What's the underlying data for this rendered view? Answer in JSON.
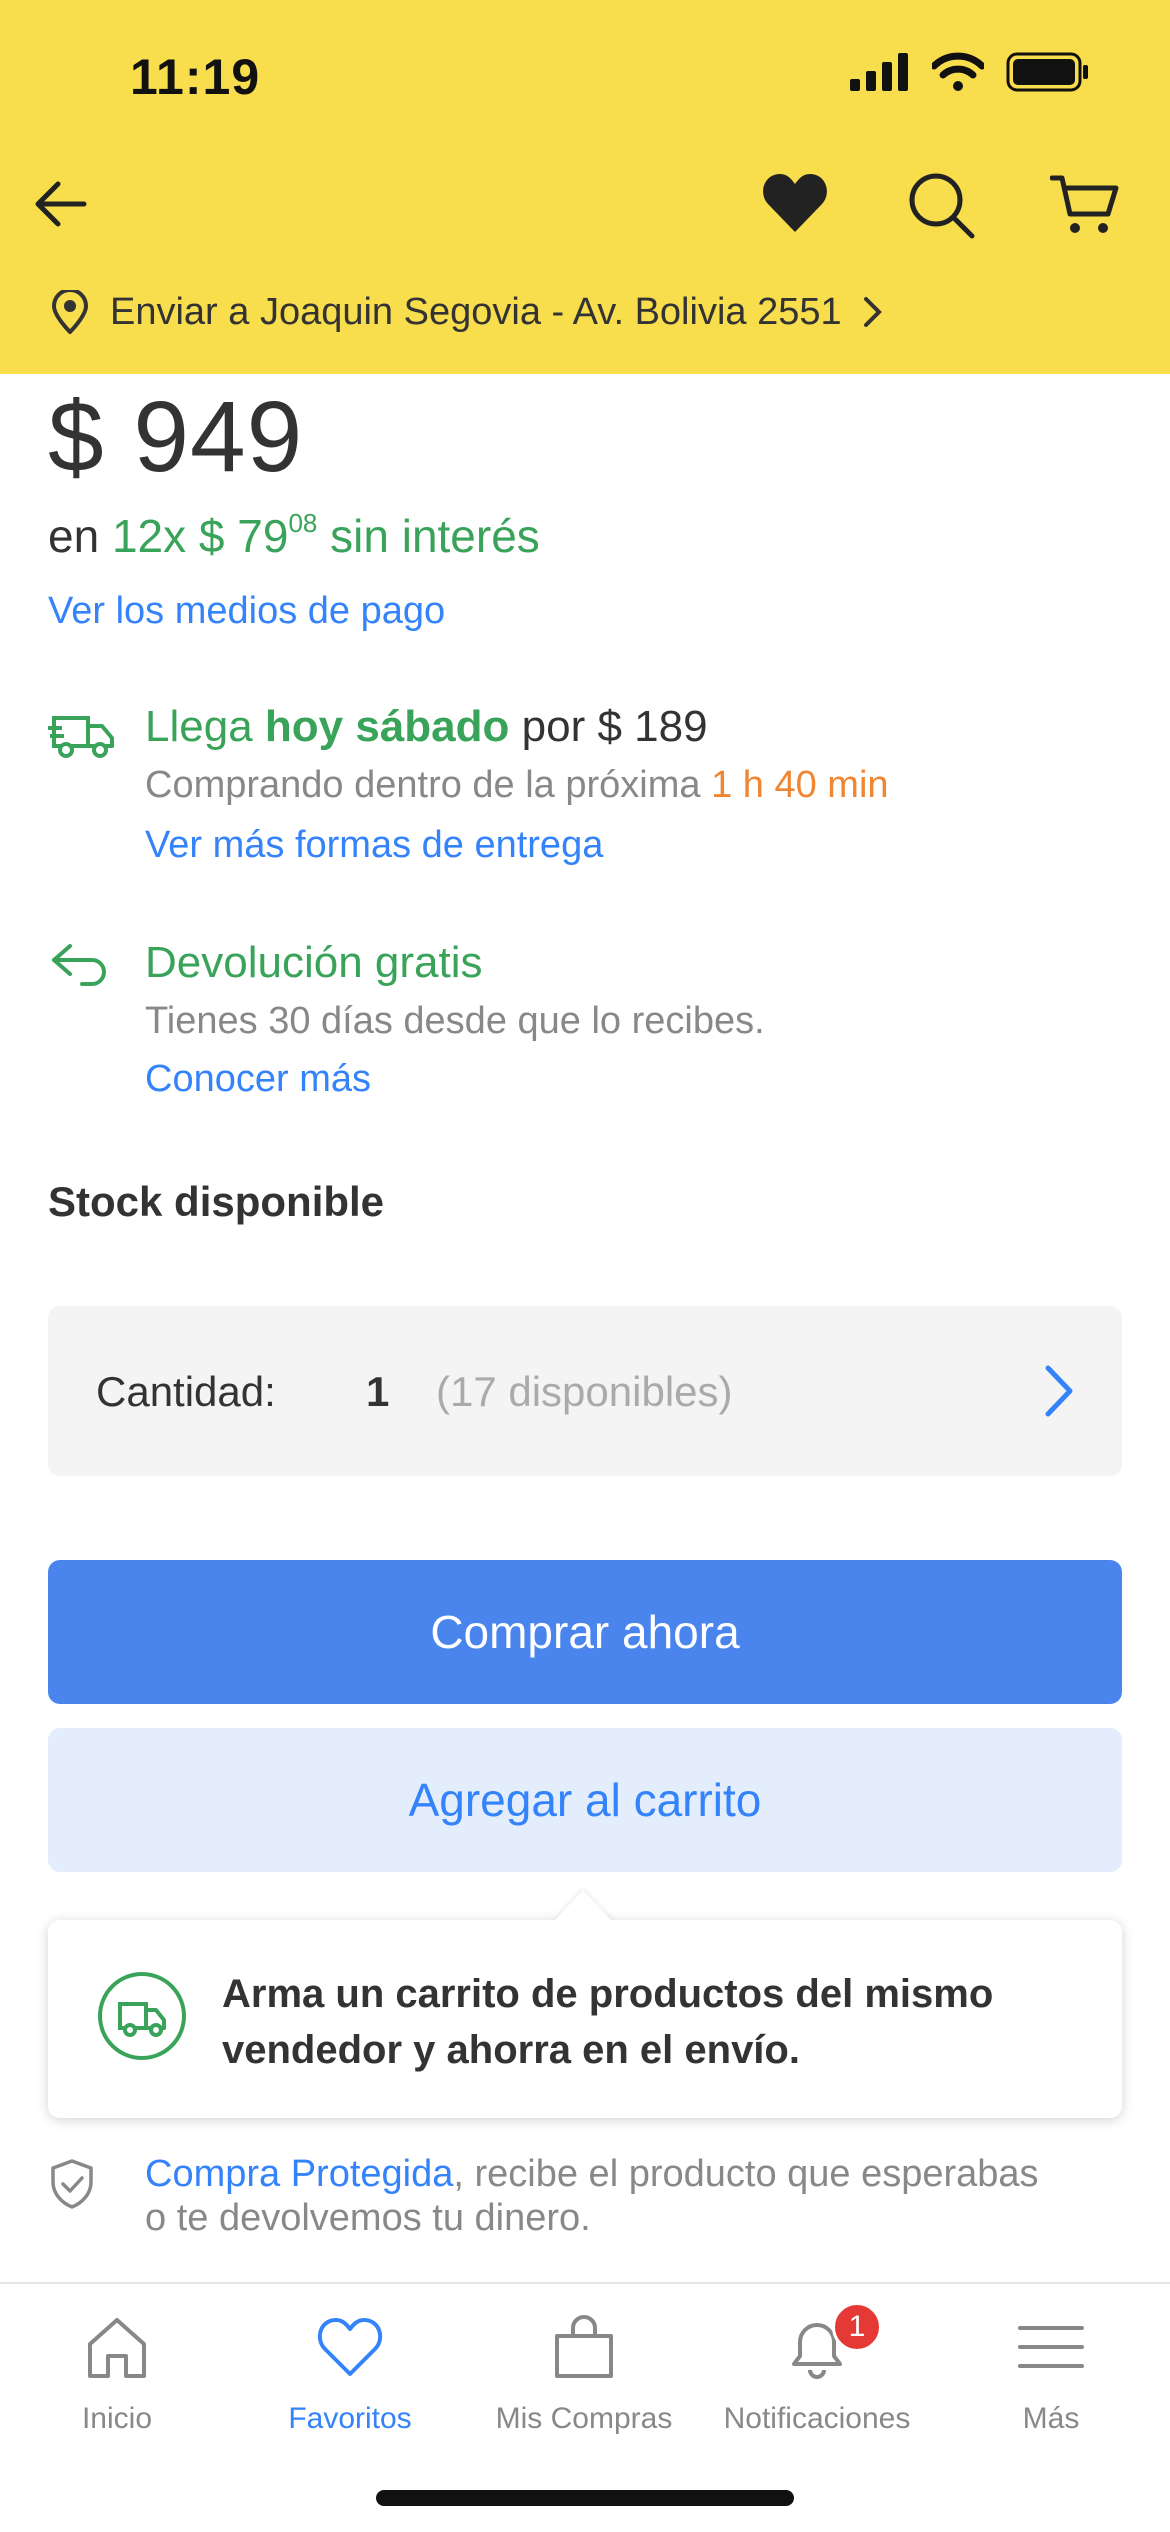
{
  "status_bar": {
    "time": "11:19"
  },
  "header": {
    "ship_to": "Enviar a Joaquin Segovia - Av. Bolivia 2551"
  },
  "product": {
    "price": "$ 949",
    "installments_prefix": "en",
    "installments_count": "12x",
    "installments_amount": "$ 79",
    "installments_cents": "08",
    "installments_suffix": "sin interés",
    "payment_link": "Ver los medios de pago"
  },
  "shipping": {
    "arrives": "Llega",
    "day": "hoy sábado",
    "price_text": "por $ 189",
    "buy_within": "Comprando dentro de la próxima",
    "time_left": "1 h 40 min",
    "more_link": "Ver más formas de entrega"
  },
  "returns": {
    "title": "Devolución gratis",
    "detail": "Tienes 30 días desde que lo recibes.",
    "link": "Conocer más"
  },
  "stock": {
    "title": "Stock disponible",
    "quantity_label": "Cantidad:",
    "quantity_value": "1",
    "available": "(17 disponibles)"
  },
  "actions": {
    "buy_now": "Comprar ahora",
    "add_to_cart": "Agregar al carrito"
  },
  "tooltip": {
    "text": "Arma un carrito de productos del mismo vendedor y ahorra en el envío."
  },
  "protection": {
    "link": "Compra Protegida",
    "text": ", recibe el producto que esperabas o te devolvemos tu dinero."
  },
  "tabbar": {
    "items": [
      {
        "label": "Inicio",
        "icon": "home-icon"
      },
      {
        "label": "Favoritos",
        "icon": "heart-icon"
      },
      {
        "label": "Mis Compras",
        "icon": "shopping-bag-icon"
      },
      {
        "label": "Notificaciones",
        "icon": "bell-icon",
        "badge": "1"
      },
      {
        "label": "Más",
        "icon": "menu-icon"
      }
    ]
  },
  "colors": {
    "header_bg": "#f8dd4c",
    "accent_blue": "#3483fa",
    "green": "#3aa35a",
    "orange": "#f08532",
    "badge_red": "#e53935"
  }
}
